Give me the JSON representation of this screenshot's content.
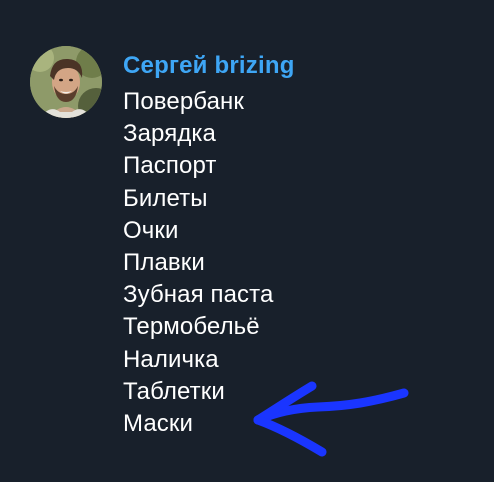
{
  "message": {
    "author": "Сергей brizing",
    "items": [
      "Повербанк",
      "Зарядка",
      "Паспорт",
      "Билеты",
      "Очки",
      "Плавки",
      "Зубная паста",
      "Термобельё",
      "Наличка",
      "Таблетки",
      "Маски"
    ]
  },
  "avatar": {
    "icon": "user-avatar-photo"
  },
  "annotation": {
    "icon": "arrow-left-icon",
    "color": "#1a35ff"
  },
  "colors": {
    "background": "#18202b",
    "author": "#3ea6f5",
    "text": "#ffffff"
  }
}
